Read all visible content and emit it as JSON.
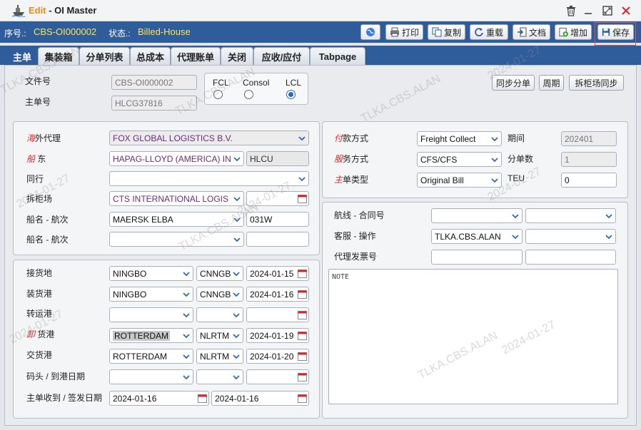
{
  "window": {
    "mode": "Edit",
    "separator": "-",
    "title": "OI Master"
  },
  "infobar": {
    "seq_label": "序号.:",
    "seq_value": "CBS-OI000002",
    "status_label": "状态.:",
    "status_value": "Billed-House"
  },
  "toolbar": {
    "print": "打印",
    "copy": "复制",
    "reload": "重载",
    "docs": "文档",
    "add": "增加",
    "save": "保存"
  },
  "tabs": [
    "主单",
    "集装箱",
    "分单列表",
    "总成本",
    "代理账单",
    "关闭",
    "应收/应付",
    "Tabpage"
  ],
  "header": {
    "file_no_label": "文件号",
    "file_no": "CBS-OI000002",
    "master_no_label": "主单号",
    "master_no": "HLCG37816",
    "mode_fcl": "FCL",
    "mode_consol": "Consol",
    "mode_lcl": "LCL",
    "sync_hbl": "同步分单",
    "period": "周期",
    "sync_cfs": "拆柜场同步"
  },
  "parties": {
    "agent_label_red": "海",
    "agent_label": "外代理",
    "agent": "FOX GLOBAL LOGISTICS B.V.",
    "carrier_label_red": "船",
    "carrier_label": "东",
    "carrier": "HAPAG-LLOYD (AMERICA) IN",
    "carrier_code": "HLCU",
    "coloader_label": "同行",
    "coloader": "",
    "cfs_label": "拆柜场",
    "cfs": "CTS INTERNATIONAL LOGIS",
    "cfs_date": "",
    "vessel_label": "船名 - 航次",
    "vessel": "MAERSK ELBA",
    "voyage": "031W",
    "vessel2_label": "船名 - 航次",
    "vessel2": "",
    "voyage2": ""
  },
  "routing": {
    "receipt_label": "接货地",
    "receipt": "NINGBO",
    "receipt_code": "CNNGB",
    "receipt_date": "2024-01-15",
    "loading_label": "装货港",
    "loading": "NINGBO",
    "loading_code": "CNNGB",
    "loading_date": "2024-01-16",
    "transit_label": "转运港",
    "discharge_label_red": "卸",
    "discharge_label": "货港",
    "discharge": "ROTTERDAM",
    "discharge_code": "NLRTM",
    "discharge_date": "2024-01-19",
    "delivery_label": "交货港",
    "delivery": "ROTTERDAM",
    "delivery_code": "NLRTM",
    "delivery_date": "2024-01-20",
    "dock_label": "码头 / 到港日期",
    "mbl_label": "主单收到 / 签发日期",
    "mbl_received": "2024-01-16",
    "mbl_issued": "2024-01-16"
  },
  "terms": {
    "payment_label_red": "付",
    "payment_label": "款方式",
    "payment": "Freight Collect",
    "period_label": "期间",
    "period": "202401",
    "service_label_red": "服",
    "service_label": "务方式",
    "service": "CFS/CFS",
    "hbl_count_label": "分单数",
    "hbl_count": "1",
    "bill_type_label_red": "主",
    "bill_type_label": "单类型",
    "bill_type": "Original Bill",
    "teu_label": "TEU",
    "teu": "0"
  },
  "ops": {
    "route_label": "航线 - 合同号",
    "cs_label": "客服 - 操作",
    "cs": "TLKA.CBS.ALAN",
    "invoice_label": "代理发票号",
    "note": "NOTE"
  },
  "watermark": {
    "user": "TLKA.CBS.ALAN",
    "date": "2024-01-27"
  },
  "colors": {
    "header_bar": "#2f5d9c",
    "status_text": "#ffe44b",
    "required_label": "#d9262c",
    "edit_text": "#e8891a"
  }
}
